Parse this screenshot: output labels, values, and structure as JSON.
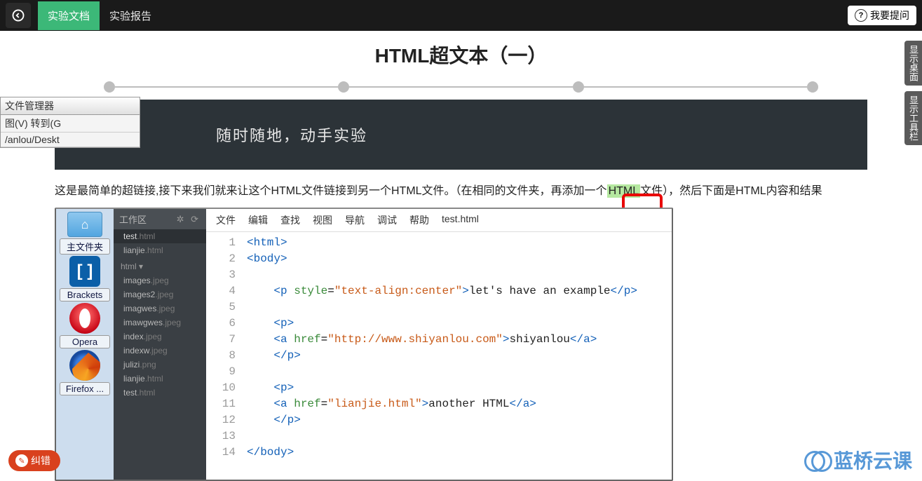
{
  "topbar": {
    "tab_active": "实验文档",
    "tab_inactive": "实验报告",
    "ask": "我要提问"
  },
  "side": {
    "show_desktop": "显示桌面",
    "show_toolbar": "显示工具栏"
  },
  "page_title": "HTML超文本（一）",
  "banner": {
    "fm_title": "文件管理器",
    "fm_row1": "图(V)    转到(G",
    "fm_row2": "/anlou/Deskt",
    "text": "随时随地，动手实验"
  },
  "desc": {
    "p1": "这是最简单的超链接,接下来我们就来让这个HTML文件链接到另一个HTML文件。（在相同的文件夹，再添加一个",
    "hl": "HTML",
    "p2": "文件），然后下面是HTML内容和结果"
  },
  "dock": {
    "home": "主文件夹",
    "brackets": "Brackets",
    "opera": "Opera",
    "firefox": "Firefox ..."
  },
  "tree": {
    "header": "工作区",
    "gear_icons": "✲ ⟳",
    "group": "html ▾",
    "files": [
      "test.html",
      "lianjie.html"
    ],
    "assets": [
      {
        "n": "images",
        "e": ".jpeg"
      },
      {
        "n": "images2",
        "e": ".jpeg"
      },
      {
        "n": "imagwes",
        "e": ".jpeg"
      },
      {
        "n": "imawgwes",
        "e": ".jpeg"
      },
      {
        "n": "index",
        "e": ".jpeg"
      },
      {
        "n": "indexw",
        "e": ".jpeg"
      },
      {
        "n": "julizi",
        "e": ".png"
      },
      {
        "n": "lianjie",
        "e": ".html"
      },
      {
        "n": "test",
        "e": ".html"
      }
    ]
  },
  "menubar": [
    "文件",
    "编辑",
    "查找",
    "视图",
    "导航",
    "调试",
    "帮助",
    "test.html"
  ],
  "code": {
    "lines": [
      {
        "n": 1,
        "h": "<span class='t-tag'>&lt;html&gt;</span>"
      },
      {
        "n": 2,
        "h": "<span class='t-tag'>&lt;body&gt;</span>"
      },
      {
        "n": 3,
        "h": ""
      },
      {
        "n": 4,
        "h": "    <span class='t-tag'>&lt;p</span> <span class='t-attr'>style</span>=<span class='t-str'>\"text-align:center\"</span><span class='t-tag'>&gt;</span><span class='t-txt'>let's have an example</span><span class='t-tag'>&lt;/p&gt;</span>"
      },
      {
        "n": 5,
        "h": ""
      },
      {
        "n": 6,
        "h": "    <span class='t-tag'>&lt;p&gt;</span>"
      },
      {
        "n": 7,
        "h": "    <span class='t-tag'>&lt;a</span> <span class='t-attr'>href</span>=<span class='t-str'>\"http://www.shiyanlou.com\"</span><span class='t-tag'>&gt;</span><span class='t-txt'>shiyanlou</span><span class='t-tag'>&lt;/a&gt;</span>"
      },
      {
        "n": 8,
        "h": "    <span class='t-tag'>&lt;/p&gt;</span>"
      },
      {
        "n": 9,
        "h": ""
      },
      {
        "n": 10,
        "h": "    <span class='t-tag'>&lt;p&gt;</span>"
      },
      {
        "n": 11,
        "h": "    <span class='t-tag'>&lt;a</span> <span class='t-attr'>href</span>=<span class='t-str'>\"lianjie.html\"</span><span class='t-tag'>&gt;</span><span class='t-txt'>another HTML</span><span class='t-tag'>&lt;/a&gt;</span>"
      },
      {
        "n": 12,
        "h": "    <span class='t-tag'>&lt;/p&gt;</span>"
      },
      {
        "n": 13,
        "h": ""
      },
      {
        "n": 14,
        "h": "<span class='t-tag'>&lt;/body&gt;</span>"
      }
    ]
  },
  "footer": {
    "error": "纠错",
    "brand": "蓝桥云课"
  }
}
